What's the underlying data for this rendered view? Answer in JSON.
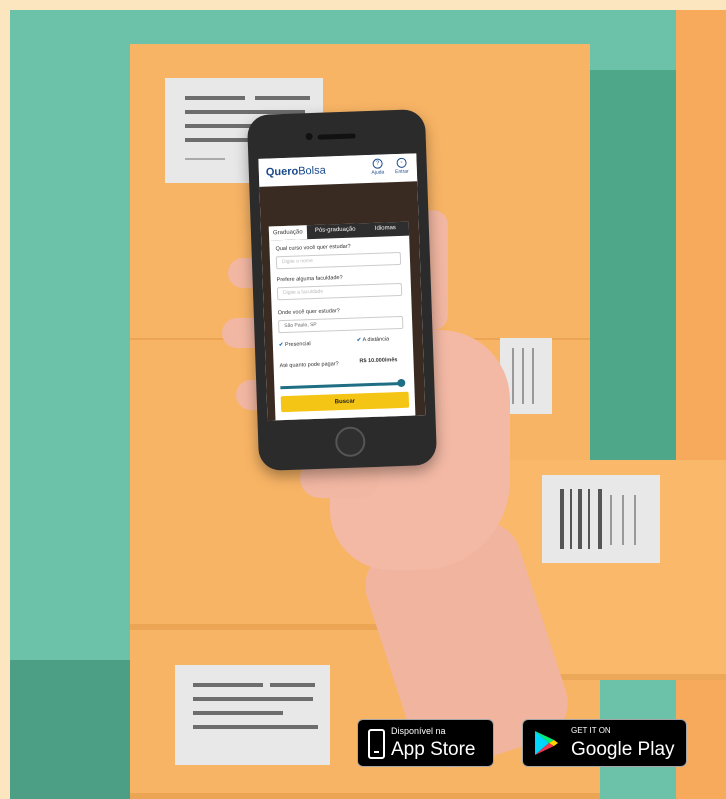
{
  "app": {
    "logo_bold": "Quero",
    "logo_regular": "Bolsa",
    "header_help": "Ajuda",
    "header_login": "Entrar"
  },
  "tabs": [
    "Graduação",
    "Pós-graduação",
    "Idiomas"
  ],
  "form": {
    "q_course": "Qual curso você quer estudar?",
    "course_placeholder": "Digite o nome",
    "q_college": "Prefere alguma faculdade?",
    "college_placeholder": "Digite a faculdade",
    "q_location": "Onde você quer estudar?",
    "location_value": "São Paulo, SP",
    "option_presencial": "Presencial",
    "option_distancia": "A distância",
    "q_budget": "Até quanto pode pagar?",
    "budget_value": "R$ 10.000/mês",
    "budget_level": 1.0,
    "search_button": "Buscar"
  },
  "badges": {
    "appstore_small": "Disponível na",
    "appstore_big": "App Store",
    "googleplay_small": "GET IT ON",
    "googleplay_big": "Google Play"
  },
  "colors": {
    "background_green": "#6cc2a8",
    "box_orange": "#f8b465",
    "brand_blue": "#1a4a8a",
    "button_yellow": "#f5c515"
  },
  "icons": [
    "apple-icon",
    "google-play-icon",
    "check-icon",
    "help-icon",
    "user-icon"
  ]
}
